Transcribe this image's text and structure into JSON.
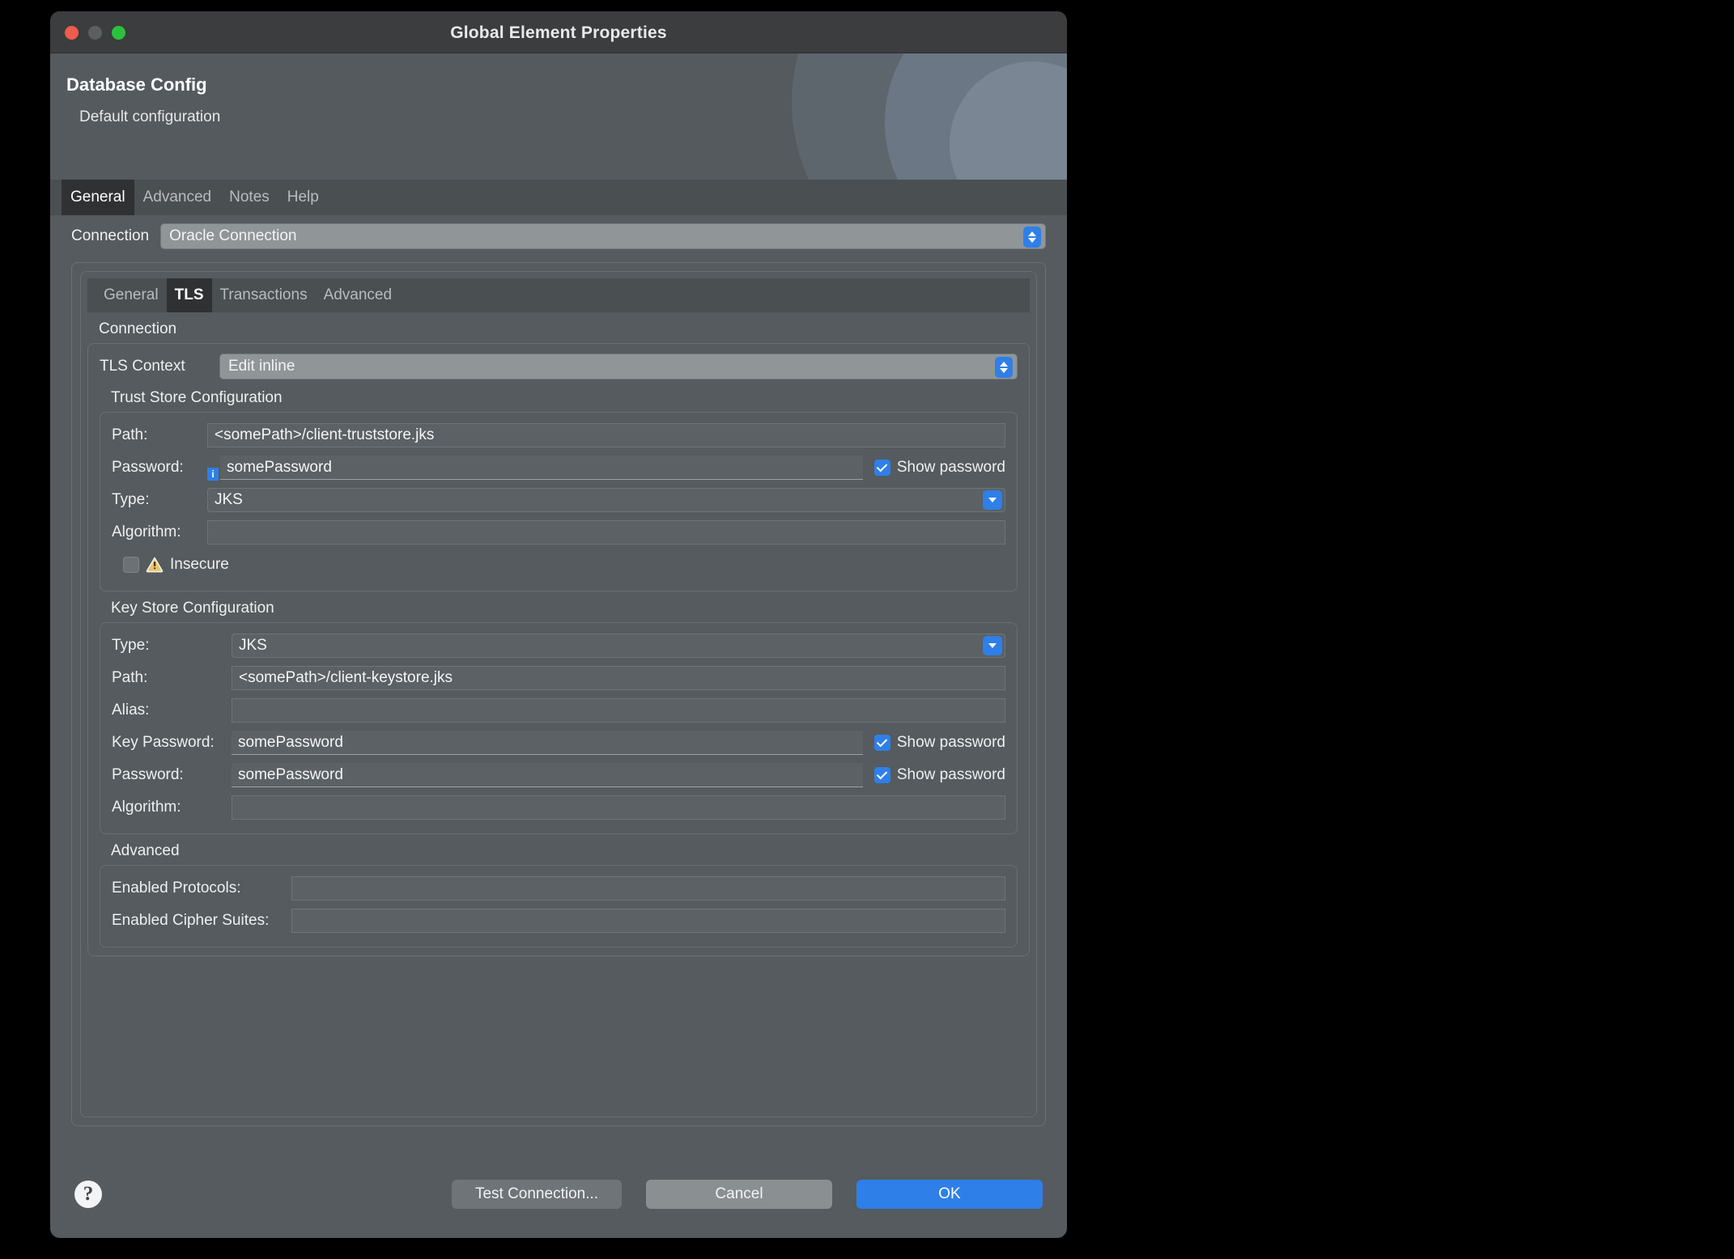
{
  "window": {
    "title": "Global Element Properties",
    "traffic_lights": [
      "close-red",
      "minimize-grey",
      "zoom-green"
    ]
  },
  "header": {
    "title": "Database Config",
    "subtitle": "Default configuration"
  },
  "outer_tabs": [
    {
      "label": "General",
      "active": true
    },
    {
      "label": "Advanced",
      "active": false
    },
    {
      "label": "Notes",
      "active": false
    },
    {
      "label": "Help",
      "active": false
    }
  ],
  "connection": {
    "label": "Connection",
    "value": "Oracle Connection"
  },
  "inner_tabs": [
    {
      "label": "General",
      "active": false
    },
    {
      "label": "TLS",
      "active": true
    },
    {
      "label": "Transactions",
      "active": false
    },
    {
      "label": "Advanced",
      "active": false
    }
  ],
  "connection_group": {
    "title": "Connection",
    "tls_context": {
      "label": "TLS Context",
      "value": "Edit inline"
    }
  },
  "trust_store": {
    "title": "Trust Store Configuration",
    "path": {
      "label": "Path:",
      "value": "<somePath>/client-truststore.jks"
    },
    "password": {
      "label": "Password:",
      "value": "somePassword",
      "show_password_label": "Show password",
      "show_password_checked": true,
      "info_icon": "i"
    },
    "type": {
      "label": "Type:",
      "value": "JKS"
    },
    "algorithm": {
      "label": "Algorithm:",
      "value": ""
    },
    "insecure": {
      "label": "Insecure",
      "checked": false
    }
  },
  "key_store": {
    "title": "Key Store Configuration",
    "type": {
      "label": "Type:",
      "value": "JKS"
    },
    "path": {
      "label": "Path:",
      "value": "<somePath>/client-keystore.jks"
    },
    "alias": {
      "label": "Alias:",
      "value": ""
    },
    "key_password": {
      "label": "Key Password:",
      "value": "somePassword",
      "show_password_label": "Show password",
      "show_password_checked": true
    },
    "password": {
      "label": "Password:",
      "value": "somePassword",
      "show_password_label": "Show password",
      "show_password_checked": true
    },
    "algorithm": {
      "label": "Algorithm:",
      "value": ""
    }
  },
  "advanced": {
    "title": "Advanced",
    "enabled_protocols": {
      "label": "Enabled Protocols:",
      "value": ""
    },
    "enabled_cipher_suites": {
      "label": "Enabled Cipher Suites:",
      "value": ""
    }
  },
  "footer": {
    "help_icon": "?",
    "test_connection": "Test Connection...",
    "cancel": "Cancel",
    "ok": "OK"
  },
  "colors": {
    "accent_blue": "#2f7fe8",
    "window_bg": "#555b5e",
    "titlebar_bg": "#3b3d3f",
    "tab_active_bg": "#2f3133",
    "warning_yellow": "#e8c46a"
  }
}
